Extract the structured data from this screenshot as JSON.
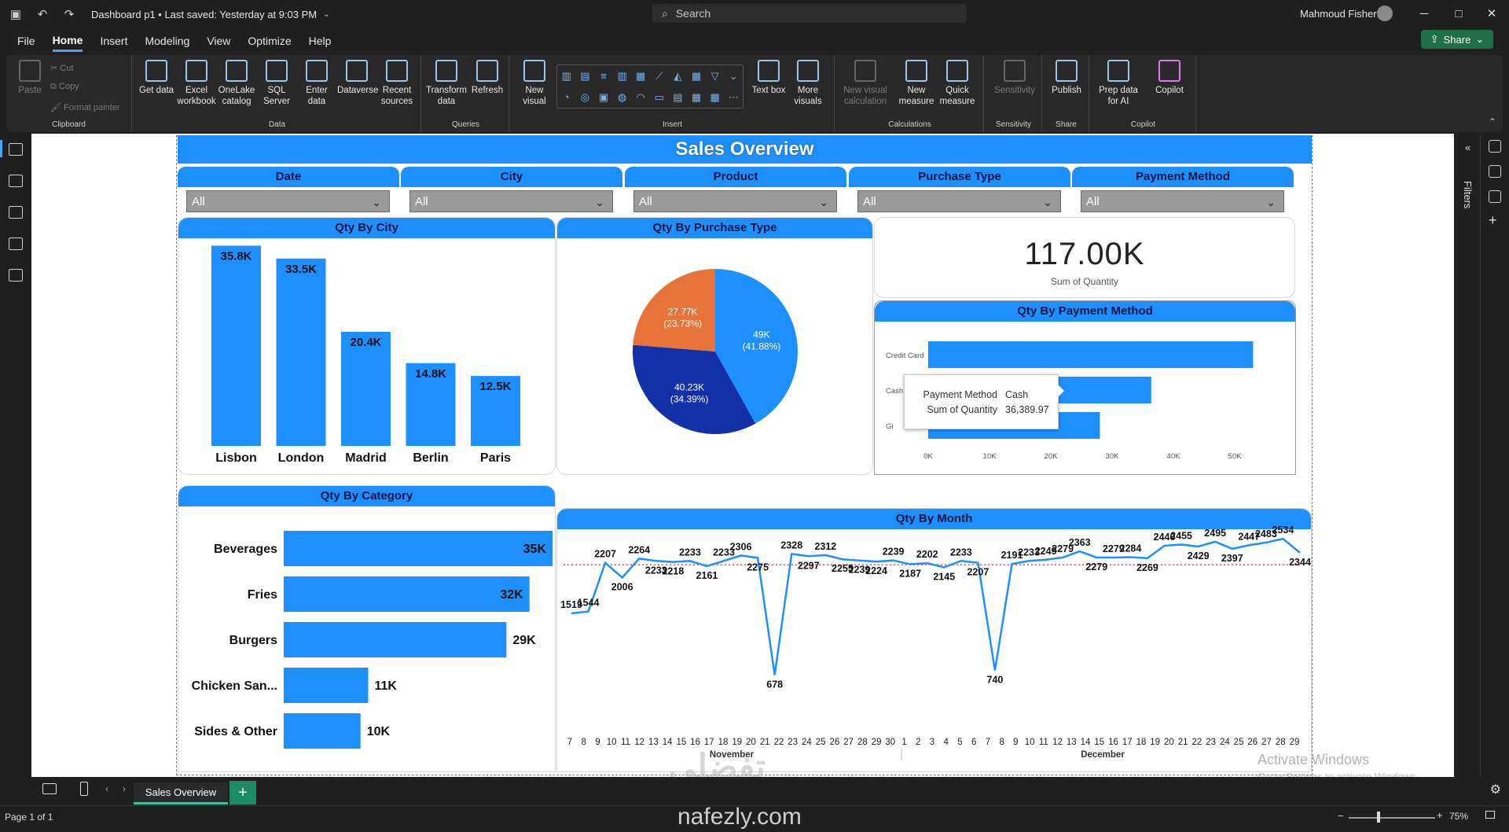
{
  "titlebar": {
    "doc_title": "Dashboard p1 • Last saved: Yesterday at 9:03 PM",
    "search_placeholder": "Search",
    "user_name": "Mahmoud Fisher"
  },
  "menu": {
    "tabs": [
      "File",
      "Home",
      "Insert",
      "Modeling",
      "View",
      "Optimize",
      "Help"
    ],
    "active": "Home",
    "share_label": "Share"
  },
  "ribbon": {
    "clipboard": {
      "paste": "Paste",
      "cut": "Cut",
      "copy": "Copy",
      "format_painter": "Format painter",
      "label": "Clipboard"
    },
    "data": {
      "buttons": [
        {
          "label": "Get data"
        },
        {
          "label": "Excel workbook"
        },
        {
          "label": "OneLake catalog"
        },
        {
          "label": "SQL Server"
        },
        {
          "label": "Enter data"
        },
        {
          "label": "Dataverse"
        },
        {
          "label": "Recent sources"
        }
      ],
      "label": "Data"
    },
    "queries": {
      "transform": "Transform data",
      "refresh": "Refresh",
      "label": "Queries"
    },
    "insert": {
      "new_visual": "New visual",
      "text_box": "Text box",
      "more_visuals": "More visuals",
      "label": "Insert"
    },
    "calculations": {
      "new_visual_calc": "New visual calculation",
      "new_measure": "New measure",
      "quick_measure": "Quick measure",
      "label": "Calculations"
    },
    "sensitivity": {
      "button": "Sensitivity",
      "label": "Sensitivity"
    },
    "share": {
      "publish": "Publish",
      "label": "Share"
    },
    "copilot": {
      "prep": "Prep data for AI",
      "copilot": "Copilot",
      "label": "Copilot"
    }
  },
  "right_rail": {
    "filters_label": "Filters"
  },
  "report": {
    "title": "Sales Overview",
    "slicers": [
      {
        "header": "Date",
        "value": "All"
      },
      {
        "header": "City",
        "value": "All"
      },
      {
        "header": "Product",
        "value": "All"
      },
      {
        "header": "Purchase Type",
        "value": "All"
      },
      {
        "header": "Payment Method",
        "value": "All"
      }
    ],
    "kpi": {
      "value": "117.00K",
      "label": "Sum of Quantity"
    },
    "tooltip": {
      "k1": "Payment Method",
      "v1": "Cash",
      "k2": "Sum of Quantity",
      "v2": "36,389.97"
    }
  },
  "chart_data": [
    {
      "type": "bar",
      "title": "Qty By City",
      "categories": [
        "Lisbon",
        "London",
        "Madrid",
        "Berlin",
        "Paris"
      ],
      "values": [
        35.8,
        33.5,
        20.4,
        14.8,
        12.5
      ],
      "data_labels": [
        "35.8K",
        "33.5K",
        "20.4K",
        "14.8K",
        "12.5K"
      ],
      "color": "#1e8fff"
    },
    {
      "type": "pie",
      "title": "Qty By Purchase Type",
      "slices": [
        {
          "label": "49K",
          "pct": "(41.88%)",
          "value": 41.88,
          "color": "#1e8fff"
        },
        {
          "label": "40.23K",
          "pct": "(34.39%)",
          "value": 34.39,
          "color": "#1430a8"
        },
        {
          "label": "27.77K",
          "pct": "(23.73%)",
          "value": 23.73,
          "color": "#e8733a"
        }
      ]
    },
    {
      "type": "bar",
      "orientation": "horizontal",
      "title": "Qty By Payment Method",
      "categories": [
        "Credit Card",
        "Cash",
        "Gi"
      ],
      "values": [
        53,
        36.39,
        28
      ],
      "xticks": [
        "0K",
        "10K",
        "20K",
        "30K",
        "40K",
        "50K"
      ],
      "xlim": [
        0,
        50
      ]
    },
    {
      "type": "bar",
      "orientation": "horizontal",
      "title": "Qty By Category",
      "categories": [
        "Beverages",
        "Fries",
        "Burgers",
        "Chicken San...",
        "Sides & Other"
      ],
      "values": [
        35,
        32,
        29,
        11,
        10
      ],
      "data_labels": [
        "35K",
        "32K",
        "29K",
        "11K",
        "10K"
      ]
    },
    {
      "type": "line",
      "title": "Qty By Month",
      "x_labels": [
        "7",
        "8",
        "9",
        "10",
        "11",
        "12",
        "13",
        "14",
        "15",
        "16",
        "17",
        "18",
        "19",
        "20",
        "21",
        "22",
        "23",
        "24",
        "25",
        "26",
        "27",
        "28",
        "29",
        "30",
        "1",
        "2",
        "3",
        "4",
        "5",
        "6",
        "7",
        "8",
        "9",
        "10",
        "11",
        "12",
        "13",
        "14",
        "15",
        "16",
        "17",
        "18",
        "19",
        "20",
        "21",
        "22",
        "23",
        "24",
        "25",
        "26",
        "27",
        "28",
        "29"
      ],
      "month_labels": [
        "November",
        "December"
      ],
      "values": [
        1519,
        1544,
        2207,
        2006,
        2264,
        2233,
        2218,
        2233,
        2161,
        2233,
        2306,
        2275,
        678,
        2328,
        2297,
        2312,
        2255,
        2239,
        2224,
        2239,
        2187,
        2202,
        2145,
        2233,
        2207,
        740,
        2191,
        2233,
        2249,
        2279,
        2363,
        2279,
        2279,
        2284,
        2269,
        2440,
        2455,
        2429,
        2495,
        2397,
        2447,
        2483,
        2534,
        2344
      ],
      "reference_line": "dotted red average line",
      "color": "#1e8fff"
    }
  ],
  "pages": {
    "tab": "Sales Overview",
    "add": "+"
  },
  "status": {
    "page_info": "Page 1 of 1",
    "zoom": "75%"
  },
  "watermark": {
    "activate_title": "Activate Windows",
    "activate_sub": "Go to Settings to activate Windows.",
    "site": "nafezly.com"
  }
}
